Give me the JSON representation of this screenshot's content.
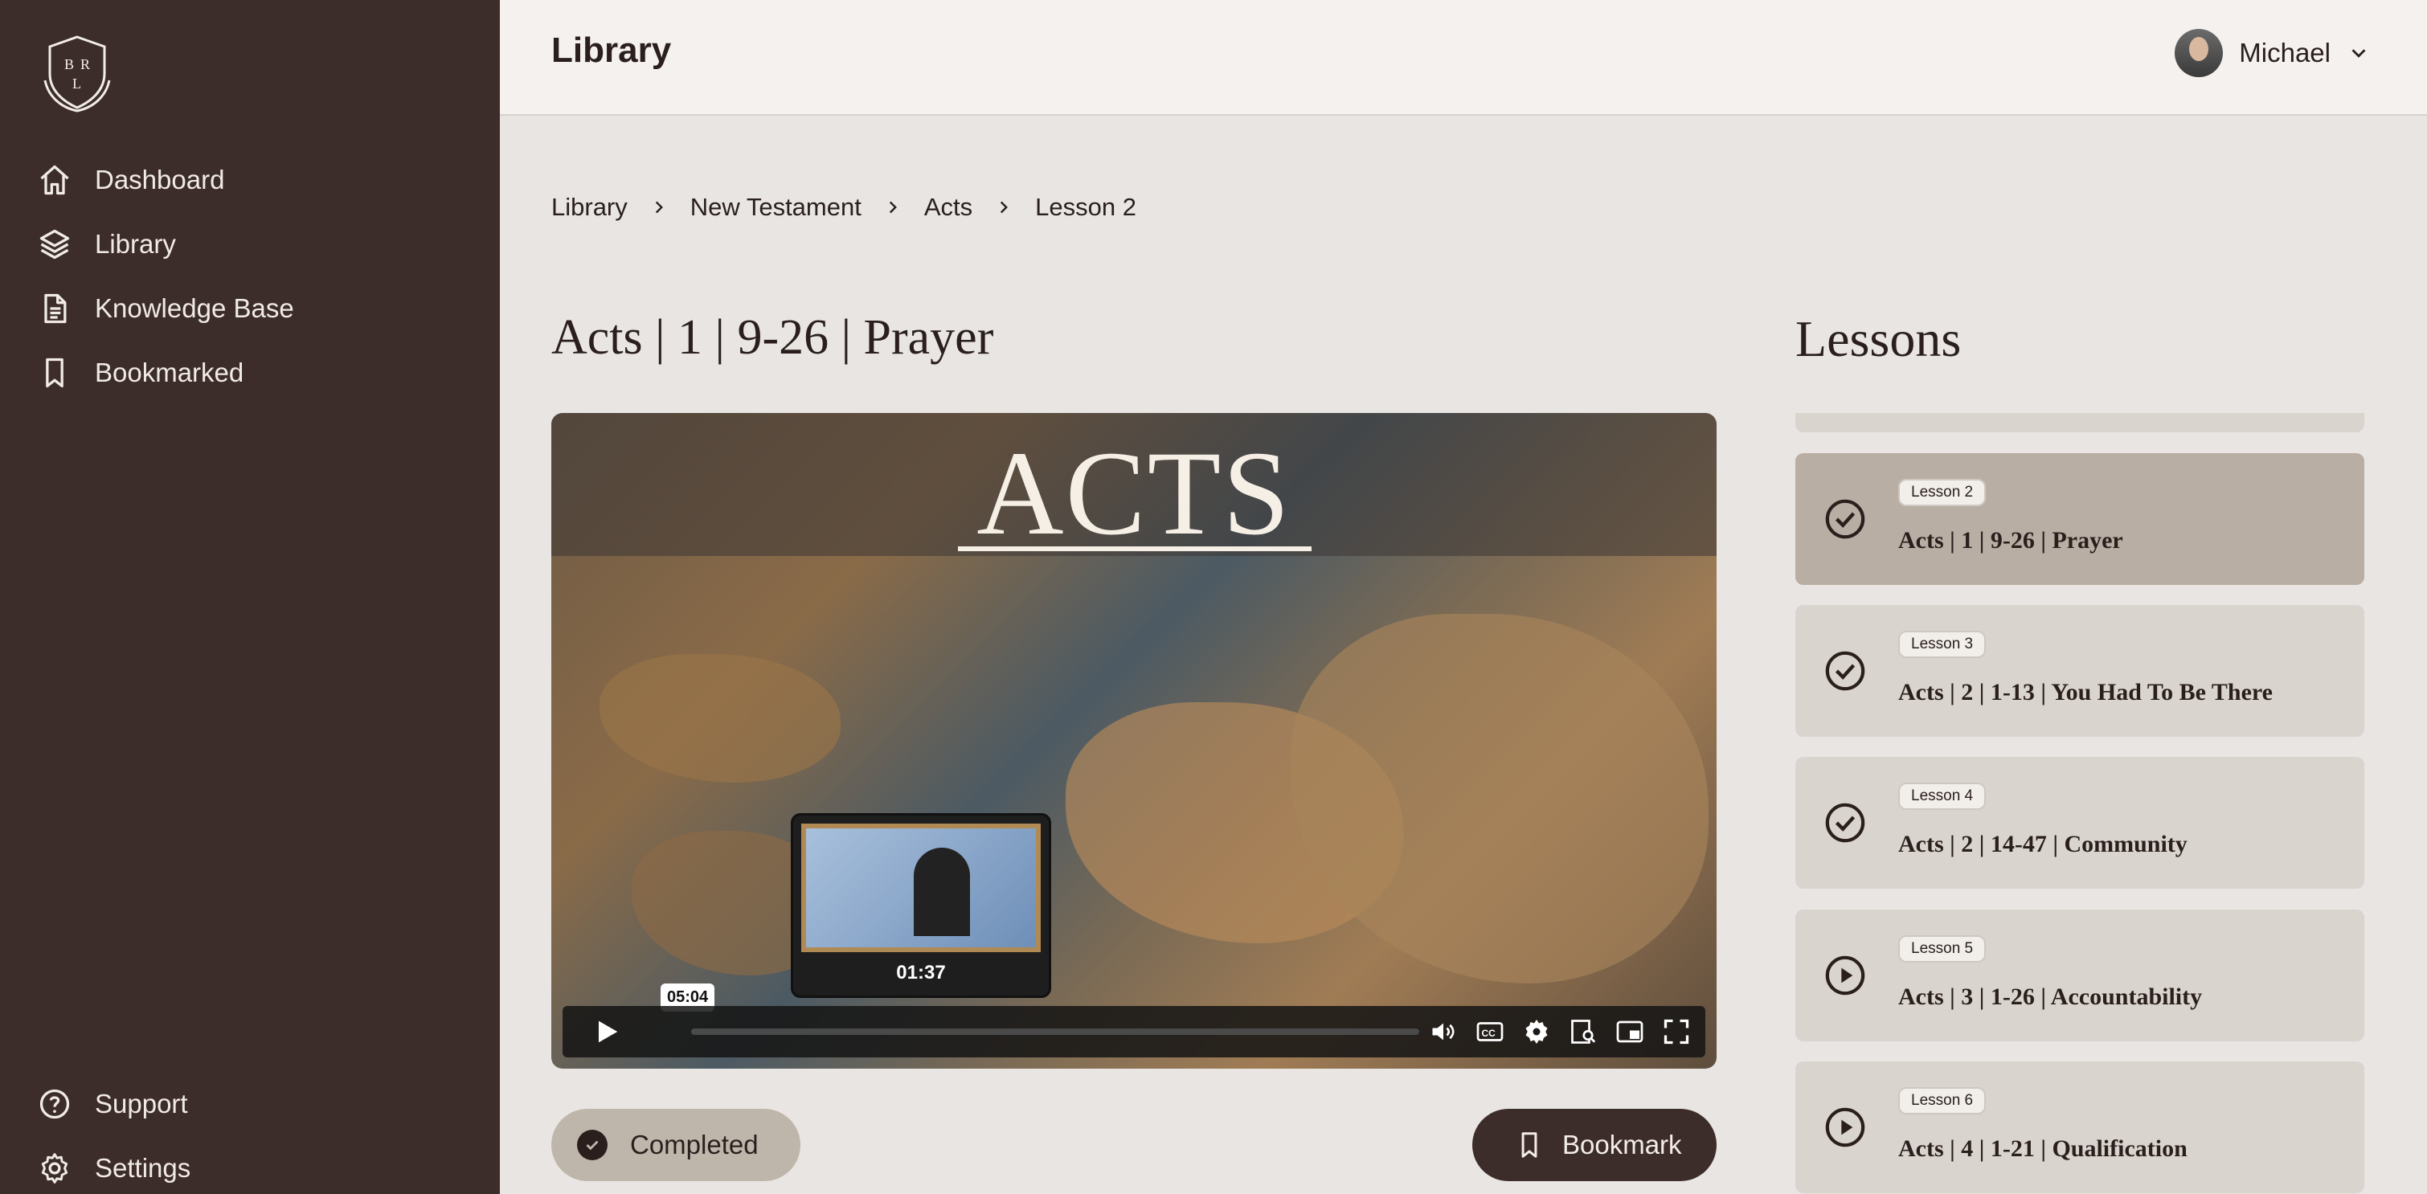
{
  "app": {
    "logo_letters": "BRL",
    "page_title": "Library"
  },
  "sidebar": {
    "items": [
      {
        "label": "Dashboard",
        "icon": "home-icon"
      },
      {
        "label": "Library",
        "icon": "layers-icon"
      },
      {
        "label": "Knowledge Base",
        "icon": "document-icon"
      },
      {
        "label": "Bookmarked",
        "icon": "bookmark-icon"
      }
    ],
    "bottom_items": [
      {
        "label": "Support",
        "icon": "help-icon"
      },
      {
        "label": "Settings",
        "icon": "gear-icon"
      }
    ]
  },
  "user": {
    "name": "Michael"
  },
  "breadcrumb": [
    "Library",
    "New Testament",
    "Acts",
    "Lesson 2"
  ],
  "lesson": {
    "title": "Acts | 1 | 9-26 | Prayer"
  },
  "player": {
    "banner_text": "ACTS",
    "preview_time": "01:37",
    "hover_time": "05:04",
    "progress": 0
  },
  "actions": {
    "completed_label": "Completed",
    "bookmark_label": "Bookmark"
  },
  "lessons": {
    "title": "Lessons",
    "items": [
      {
        "badge": "Lesson 2",
        "name": "Acts | 1 | 9-26 | Prayer",
        "status": "completed",
        "active": true
      },
      {
        "badge": "Lesson 3",
        "name": "Acts | 2 | 1-13 | You Had To Be There",
        "status": "completed",
        "active": false
      },
      {
        "badge": "Lesson 4",
        "name": "Acts | 2 | 14-47 | Community",
        "status": "completed",
        "active": false
      },
      {
        "badge": "Lesson 5",
        "name": "Acts | 3 | 1-26 | Accountability",
        "status": "play",
        "active": false
      },
      {
        "badge": "Lesson 6",
        "name": "Acts | 4 | 1-21 | Qualification",
        "status": "play",
        "active": false
      }
    ]
  },
  "colors": {
    "sidebar_bg": "#3d2d2a",
    "active_card": "#b9aea3",
    "card": "#d9d4ce"
  }
}
